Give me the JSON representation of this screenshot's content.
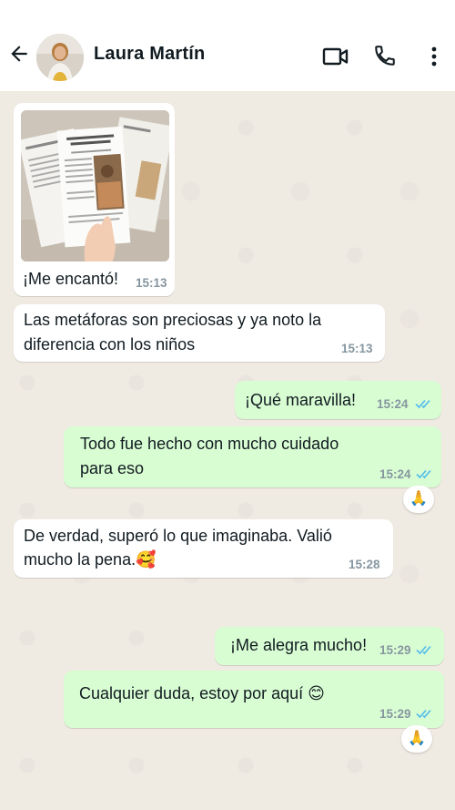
{
  "header": {
    "contact_name": "Laura Martín",
    "icons": [
      "back-arrow-icon",
      "video-call-icon",
      "phone-icon",
      "more-vert-icon"
    ]
  },
  "colors": {
    "incoming_bubble": "#ffffff",
    "outgoing_bubble": "#d9fdd3",
    "read_ticks": "#53bdeb",
    "timestamp": "#8696a0"
  },
  "messages": [
    {
      "direction": "in",
      "type": "image",
      "caption": "¡Me encantó!",
      "time": "15:13"
    },
    {
      "direction": "in",
      "text_line1": "Las metáforas son preciosas y ya noto la",
      "text_line2": "diferencia con los niños",
      "time": "15:13"
    },
    {
      "direction": "out",
      "text": "¡Qué maravilla!",
      "time": "15:24",
      "status": "read"
    },
    {
      "direction": "out",
      "text_line1": "Todo fue hecho con mucho cuidado",
      "text_line2": "para eso",
      "time": "15:24",
      "status": "read",
      "reaction": "🙏"
    },
    {
      "direction": "in",
      "text_line1": "De verdad, superó lo que imaginaba. Valió",
      "text_line2": "mucho la pena.🥰",
      "time": "15:28"
    },
    {
      "direction": "out",
      "text": "¡Me alegra mucho!",
      "time": "15:29",
      "status": "read"
    },
    {
      "direction": "out",
      "text": "Cualquier duda, estoy por aquí 😊",
      "time": "15:29",
      "status": "read",
      "reaction": "🙏"
    }
  ]
}
